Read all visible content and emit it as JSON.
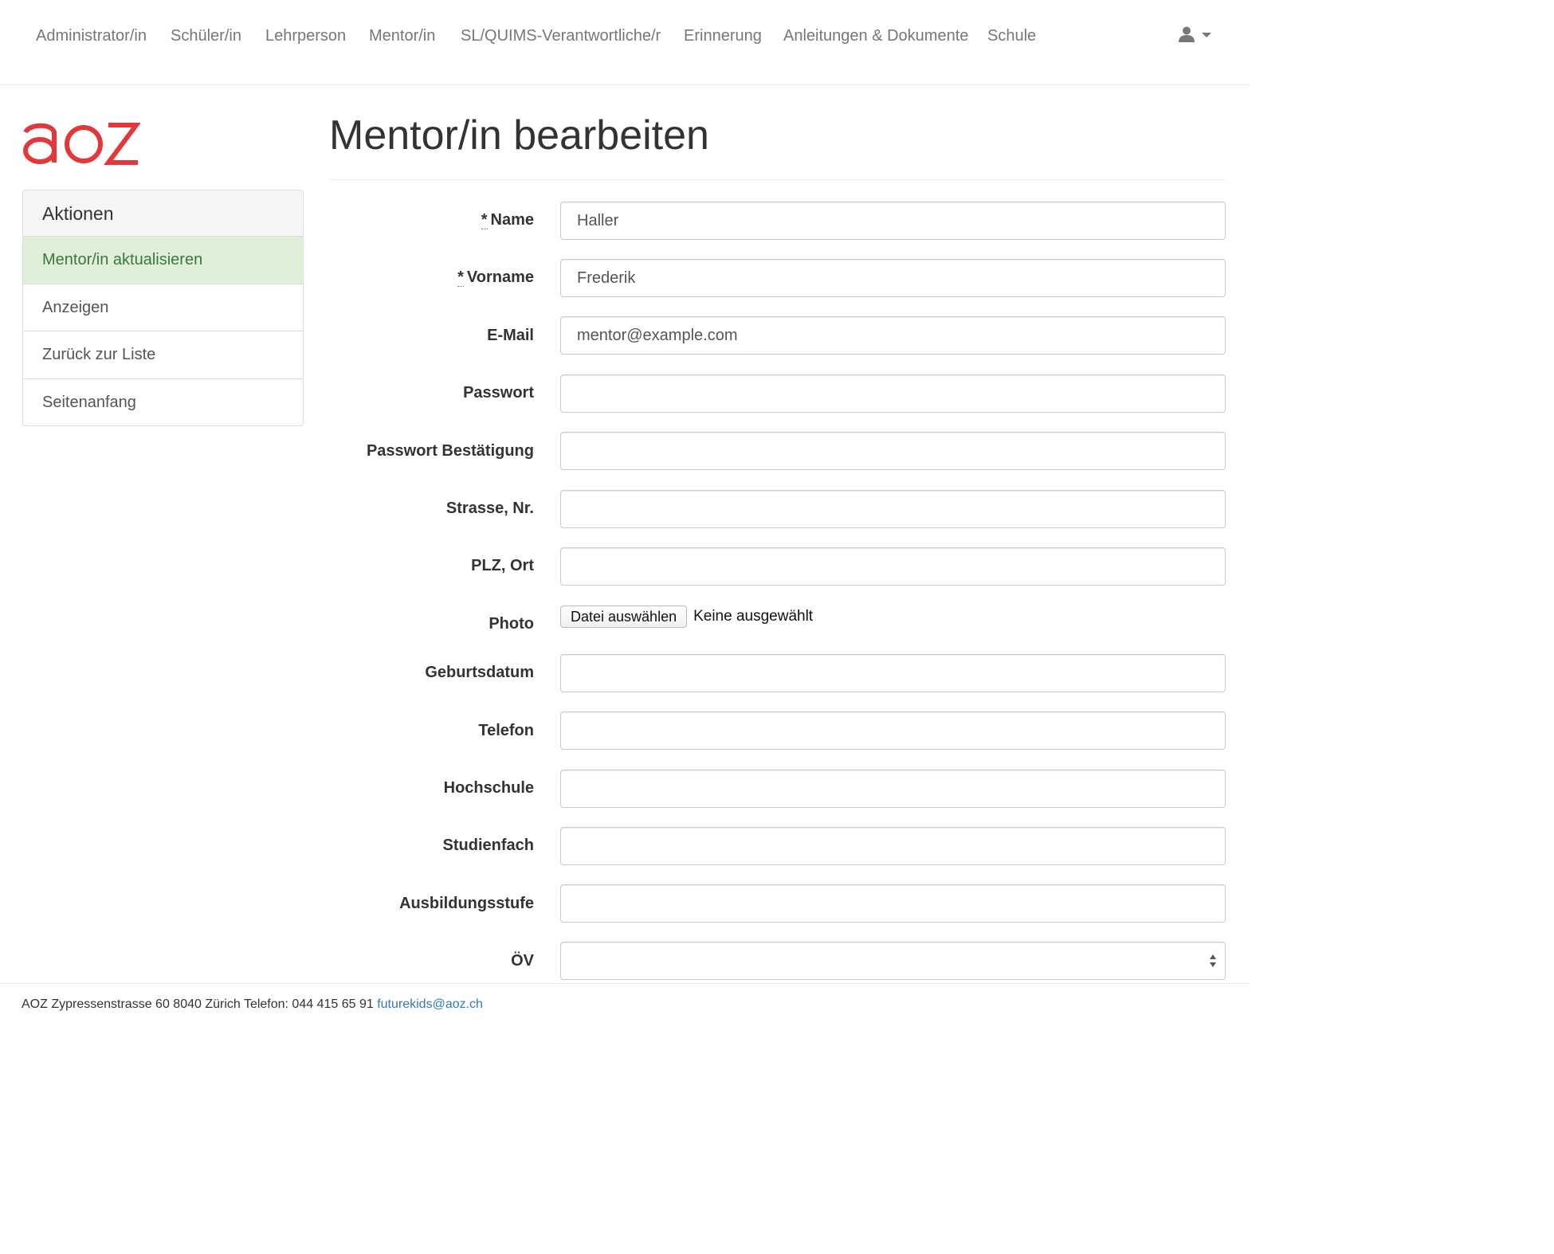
{
  "nav": {
    "items": [
      {
        "label": "Administrator/in"
      },
      {
        "label": "Schüler/in"
      },
      {
        "label": "Lehrperson"
      },
      {
        "label": "Mentor/in"
      },
      {
        "label": "SL/QUIMS-Verantwortliche/r"
      },
      {
        "label": "Erinnerung"
      },
      {
        "label": "Anleitungen & Dokumente"
      },
      {
        "label": "Schule"
      }
    ],
    "user_icon": "user-icon"
  },
  "logo": {
    "text": "aoz",
    "color": "#e2373b"
  },
  "sidebar": {
    "heading": "Aktionen",
    "items": [
      {
        "label": "Mentor/in aktualisieren"
      },
      {
        "label": "Anzeigen"
      },
      {
        "label": "Zurück zur Liste"
      },
      {
        "label": "Seitenanfang"
      }
    ]
  },
  "page": {
    "title": "Mentor/in bearbeiten"
  },
  "form": {
    "fields": [
      {
        "label": "Name",
        "required_mark": "*",
        "value": "Haller"
      },
      {
        "label": "Vorname",
        "required_mark": "*",
        "value": "Frederik"
      },
      {
        "label": "E-Mail",
        "value": "mentor@example.com"
      },
      {
        "label": "Passwort",
        "value": ""
      },
      {
        "label": "Passwort Bestätigung",
        "value": ""
      },
      {
        "label": "Strasse, Nr.",
        "value": ""
      },
      {
        "label": "PLZ, Ort",
        "value": ""
      },
      {
        "label": "Photo",
        "button_label": "Datei auswählen",
        "status": "Keine ausgewählt"
      },
      {
        "label": "Geburtsdatum",
        "value": ""
      },
      {
        "label": "Telefon",
        "value": ""
      },
      {
        "label": "Hochschule",
        "value": ""
      },
      {
        "label": "Studienfach",
        "value": ""
      },
      {
        "label": "Ausbildungsstufe",
        "value": ""
      },
      {
        "label": "ÖV",
        "value": ""
      }
    ]
  },
  "footer": {
    "text": "AOZ Zypressenstrasse 60 8040 Zürich Telefon: 044 415 65 91",
    "email": "futurekids@aoz.ch",
    "link_color": "#337ab7"
  },
  "colors": {
    "active_bg": "#dff0d8",
    "active_text": "#3c763d",
    "nav_text": "#777777"
  }
}
